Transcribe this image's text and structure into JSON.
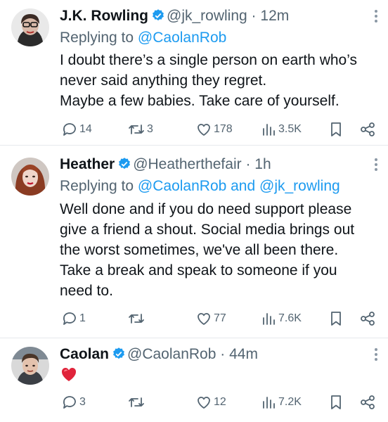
{
  "colors": {
    "link": "#1d9bf0",
    "verified": "#1d9bf0",
    "muted": "#536471",
    "text": "#0f1419",
    "heart": "#e0243b"
  },
  "tweets": [
    {
      "name": "J.K. Rowling",
      "handle": "@jk_rowling",
      "separator": "·",
      "time": "12m",
      "replying_prefix": "Replying to",
      "replying_to": "@CaolanRob",
      "lines": [
        "I doubt there’s a single person on earth who’s",
        "never said anything they regret.",
        "Maybe a few babies. Take care of yourself."
      ],
      "stats": {
        "replies": "14",
        "reposts": "3",
        "likes": "178",
        "views": "3.5K"
      }
    },
    {
      "name": "Heather",
      "handle": "@Heatherthefair",
      "separator": "·",
      "time": "1h",
      "replying_prefix": "Replying to",
      "replying_to": "@CaolanRob and @jk_rowling",
      "lines": [
        "Well done and if you do need support please",
        "give a friend a shout. Social media brings out",
        "the worst sometimes, we've all been there.",
        "Take a break and speak to someone if you",
        "need to."
      ],
      "stats": {
        "replies": "1",
        "reposts": "",
        "likes": "77",
        "views": "7.6K"
      }
    },
    {
      "name": "Caolan",
      "handle": "@CaolanRob",
      "separator": "·",
      "time": "44m",
      "emoji": "red-heart",
      "stats": {
        "replies": "3",
        "reposts": "",
        "likes": "12",
        "views": "7.2K"
      }
    }
  ],
  "icons": [
    "verified-badge-icon",
    "reply-icon",
    "repost-icon",
    "like-icon",
    "views-icon",
    "bookmark-icon",
    "share-icon",
    "more-icon"
  ]
}
